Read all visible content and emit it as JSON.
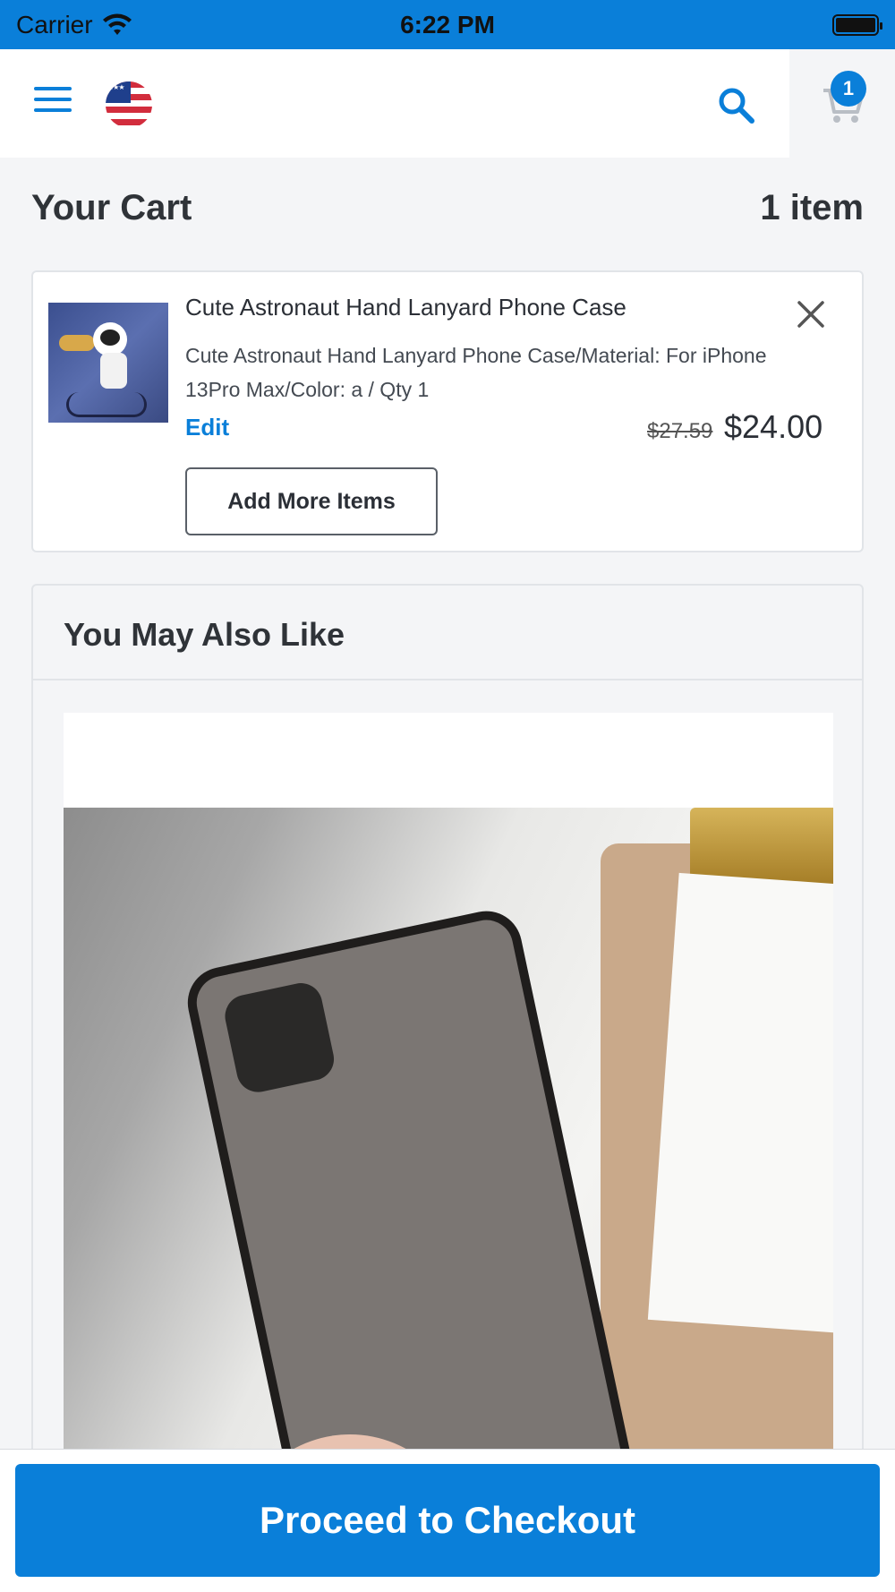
{
  "status_bar": {
    "carrier": "Carrier",
    "time": "6:22 PM"
  },
  "header": {
    "menu_icon": "hamburger-icon",
    "flag_icon": "us-flag-icon",
    "search_icon": "search-icon",
    "cart_icon": "cart-icon",
    "cart_count": "1"
  },
  "cart": {
    "title": "Your Cart",
    "item_count": "1 item",
    "item": {
      "title": "Cute Astronaut Hand Lanyard Phone Case",
      "description": "Cute Astronaut Hand Lanyard Phone Case/Material: For iPhone 13Pro Max/Color: a / Qty 1",
      "edit_label": "Edit",
      "original_price": "$27.59",
      "price": "$24.00"
    },
    "add_more_label": "Add More Items"
  },
  "recommendations": {
    "title": "You May Also Like"
  },
  "checkout": {
    "label": "Proceed to Checkout"
  },
  "colors": {
    "accent": "#0a7fd9",
    "background": "#f4f5f7"
  }
}
